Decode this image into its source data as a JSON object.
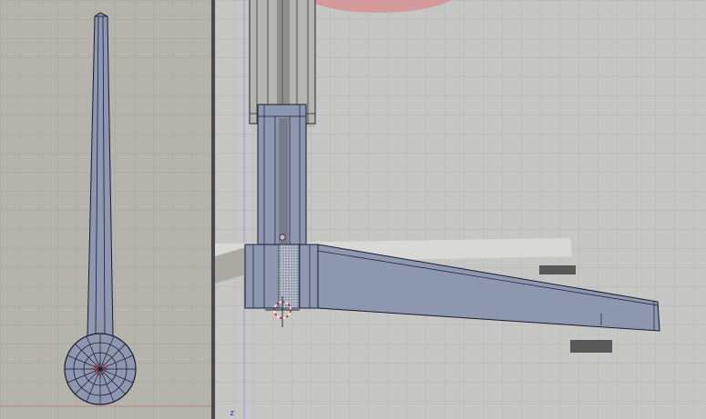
{
  "viewports": {
    "left": {
      "view": "top"
    },
    "right": {
      "view": "front",
      "axis_label": "z"
    }
  },
  "colors": {
    "mesh_fill": "#8d97b0",
    "mesh_edge": "#1a1a2e",
    "grid_line": "#a9a9a4",
    "cursor_red": "#cc0000",
    "origin_dot": "#d9a9d0",
    "ref_pink": "#d49a9c",
    "axis_z": "#2030d0",
    "left_bg": "#b5b4ac",
    "right_bg": "#c6c6c4"
  }
}
